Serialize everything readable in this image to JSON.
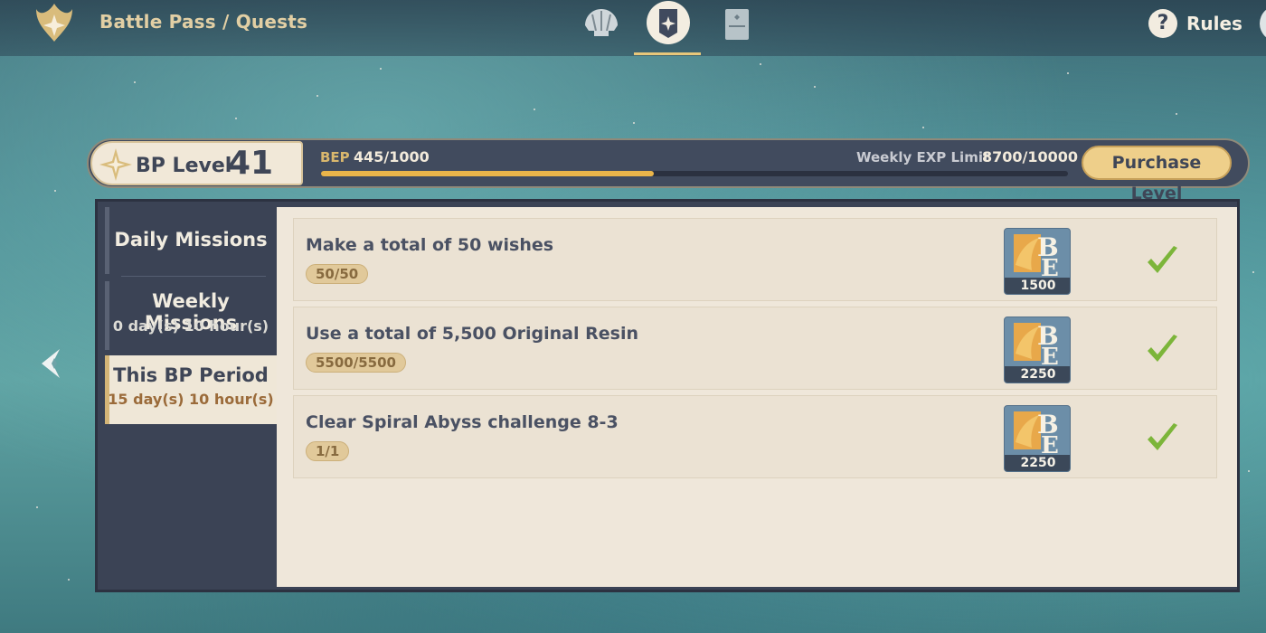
{
  "header": {
    "breadcrumb": "Battle Pass / Quests",
    "rules_label": "Rules",
    "rules_icon": "?",
    "tabs": [
      "shell-icon",
      "quest-banner-icon",
      "card-icon"
    ],
    "active_tab": 1
  },
  "bp": {
    "level_label": "BP Level",
    "level_value": "41",
    "bep_label": "BEP",
    "bep_value": "445/1000",
    "bep_progress": 0.445,
    "weekly_label": "Weekly EXP Limit",
    "weekly_value": "8700/10000",
    "purchase_label": "Purchase Level"
  },
  "sidebar": {
    "daily": {
      "label": "Daily Missions"
    },
    "weekly": {
      "label": "Weekly Missions",
      "sub": "0 day(s) 10 hour(s)"
    },
    "period": {
      "label": "This BP Period",
      "sub": "15 day(s) 10 hour(s)"
    },
    "active": "period"
  },
  "quests": [
    {
      "title": "Make a total of 50 wishes",
      "progress": "50/50",
      "reward": "1500",
      "completed": true
    },
    {
      "title": "Use a total of 5,500 Original Resin",
      "progress": "5500/5500",
      "reward": "2250",
      "completed": true
    },
    {
      "title": "Clear Spiral Abyss challenge 8-3",
      "progress": "1/1",
      "reward": "2250",
      "completed": true
    }
  ],
  "colors": {
    "accent_gold": "#eab54a",
    "check_green": "#7cb53a",
    "panel_dark": "#3b4355",
    "panel_light": "#efe7da"
  }
}
